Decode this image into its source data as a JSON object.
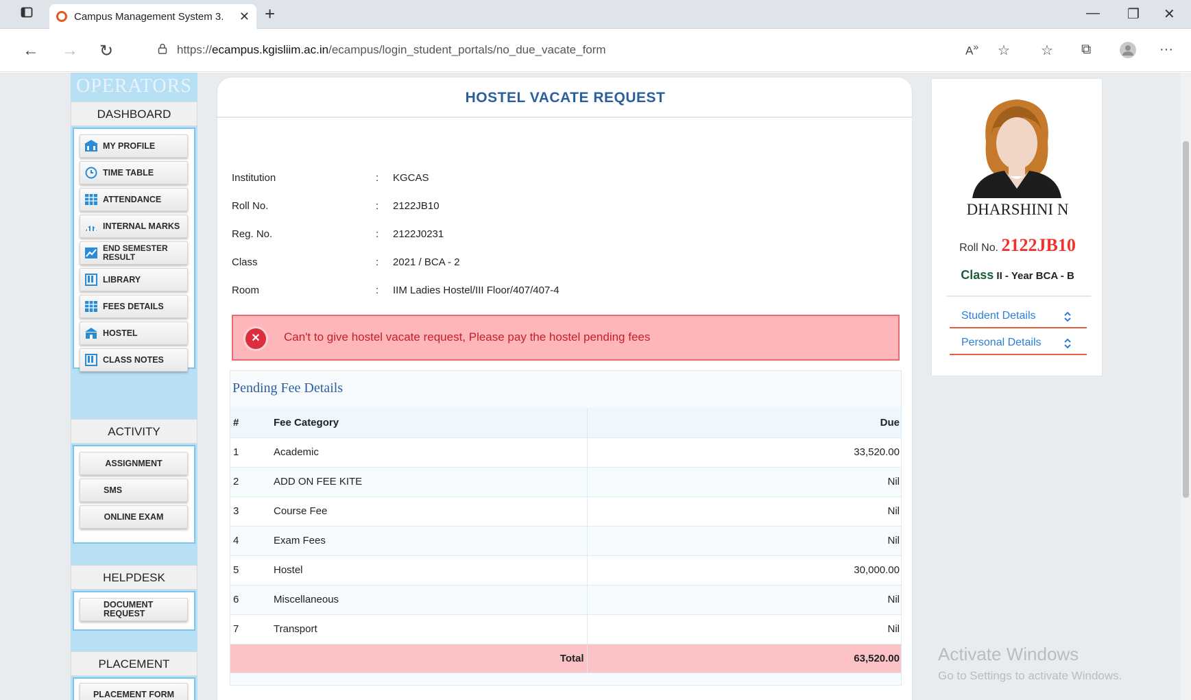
{
  "browser": {
    "tab_title": "Campus Management System 3.",
    "url_prefix": "https://",
    "url_domain": "ecampus.kgisliim.ac.in",
    "url_path": "/ecampus/login_student_portals/no_due_vacate_form"
  },
  "sidebar": {
    "brand": "OPERATORS",
    "dashboard": "DASHBOARD",
    "dashboard_items": [
      {
        "label": "MY PROFILE",
        "icon": "profile-icon"
      },
      {
        "label": "TIME TABLE",
        "icon": "clock-icon"
      },
      {
        "label": "ATTENDANCE",
        "icon": "grid-icon"
      },
      {
        "label": "INTERNAL MARKS",
        "icon": "chart-icon"
      },
      {
        "label": "END SEMESTER RESULT",
        "icon": "trend-icon"
      },
      {
        "label": "LIBRARY",
        "icon": "book-icon"
      },
      {
        "label": "FEES DETAILS",
        "icon": "grid-icon"
      },
      {
        "label": "HOSTEL",
        "icon": "building-icon"
      },
      {
        "label": "CLASS NOTES",
        "icon": "book-icon"
      }
    ],
    "activity": "ACTIVITY",
    "activity_items": [
      "ASSIGNMENT",
      "SMS",
      "ONLINE EXAM"
    ],
    "helpdesk": "HELPDESK",
    "helpdesk_items": [
      "DOCUMENT REQUEST"
    ],
    "placement": "PLACEMENT",
    "placement_items": [
      "PLACEMENT FORM"
    ]
  },
  "main": {
    "title": "HOSTEL VACATE REQUEST",
    "info": [
      {
        "label": "Institution",
        "value": "KGCAS"
      },
      {
        "label": "Roll No.",
        "value": "2122JB10"
      },
      {
        "label": "Reg. No.",
        "value": "2122J0231"
      },
      {
        "label": "Class",
        "value": "2021 / BCA - 2"
      },
      {
        "label": "Room",
        "value": "IIM Ladies Hostel/III Floor/407/407-4"
      }
    ],
    "separator": ":",
    "alert": "Can't to give hostel vacate request, Please pay the hostel pending fees",
    "fee_section_title": "Pending Fee Details",
    "fee_headers": [
      "#",
      "Fee Category",
      "Due"
    ],
    "fees": [
      {
        "no": "1",
        "category": "Academic",
        "due": "33,520.00"
      },
      {
        "no": "2",
        "category": "ADD ON FEE KITE",
        "due": "Nil"
      },
      {
        "no": "3",
        "category": "Course Fee",
        "due": "Nil"
      },
      {
        "no": "4",
        "category": "Exam Fees",
        "due": "Nil"
      },
      {
        "no": "5",
        "category": "Hostel",
        "due": "30,000.00"
      },
      {
        "no": "6",
        "category": "Miscellaneous",
        "due": "Nil"
      },
      {
        "no": "7",
        "category": "Transport",
        "due": "Nil"
      }
    ],
    "total_label": "Total",
    "total_value": "63,520.00"
  },
  "profile": {
    "name": "DHARSHINI N",
    "roll_label": "Roll No.",
    "roll_value": "2122JB10",
    "class_label": "Class",
    "class_value": "II - Year BCA - B",
    "links": [
      "Student Details",
      "Personal Details"
    ]
  },
  "watermark": {
    "line1": "Activate Windows",
    "line2": "Go to Settings to activate Windows."
  },
  "colors": {
    "accent_blue": "#2a5f9e",
    "alert_red": "#c41e2a",
    "sidebar_blue": "#b8e0f5",
    "roll_red": "#f0322b"
  }
}
